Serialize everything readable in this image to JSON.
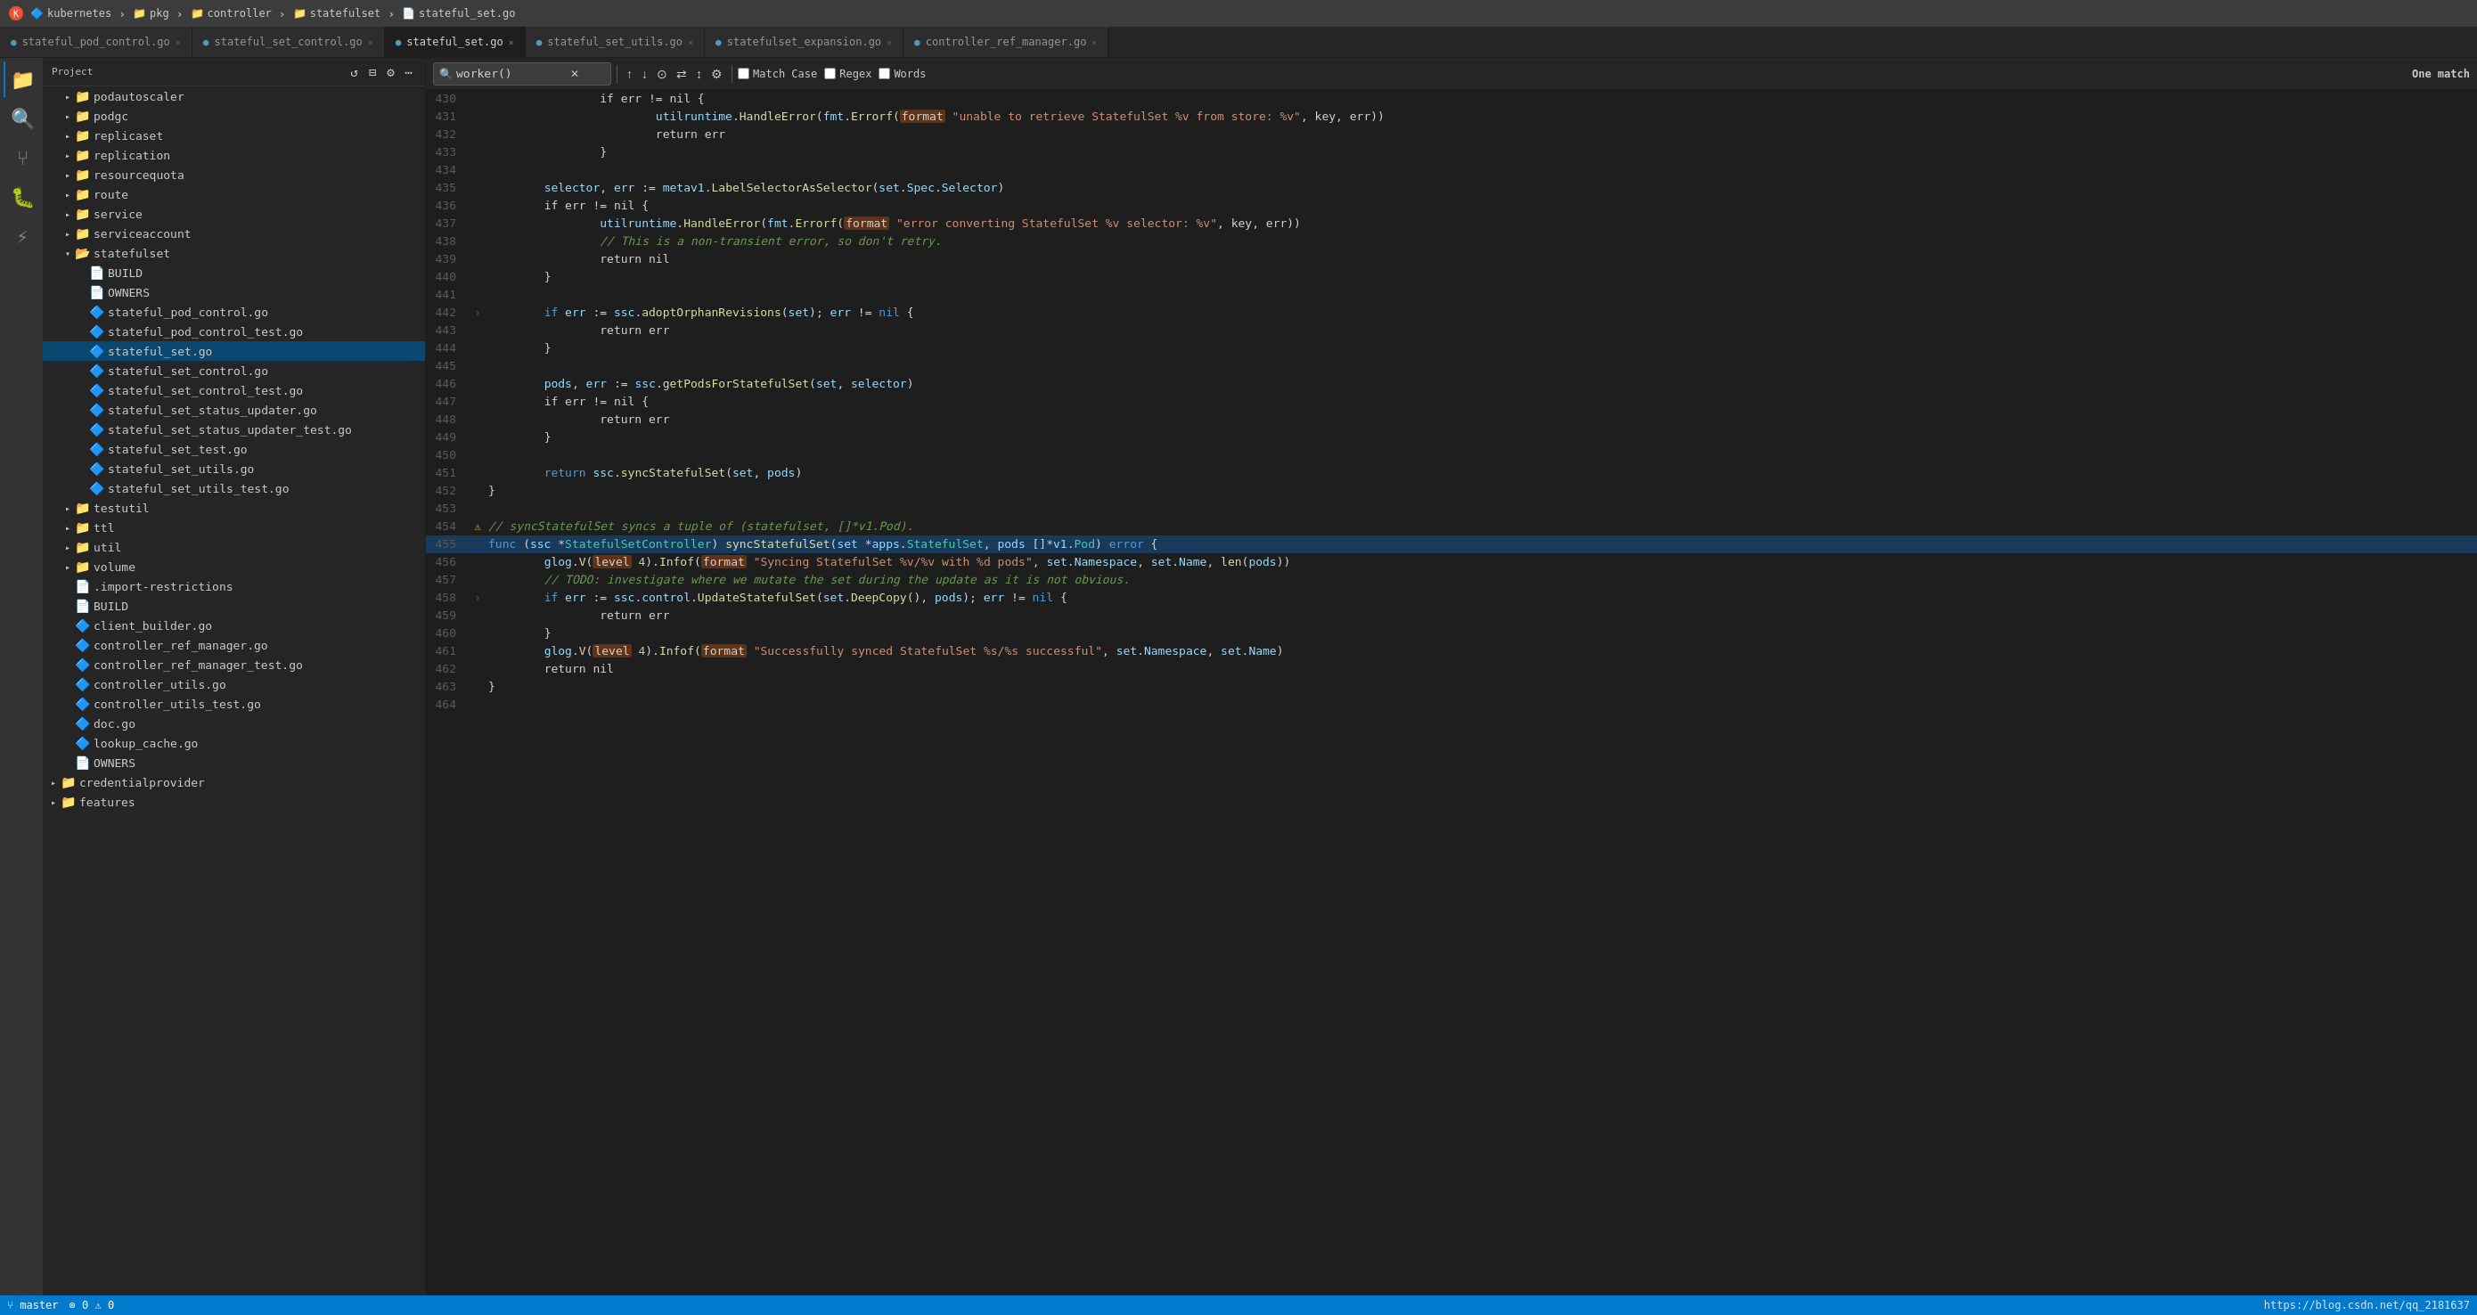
{
  "titlebar": {
    "icon_label": "K",
    "breadcrumb": [
      "kubernetes",
      "pkg",
      "controller",
      "statefulset",
      "stateful_set.go"
    ]
  },
  "tabs": [
    {
      "id": "stateful_pod_control",
      "label": "stateful_pod_control.go",
      "active": false,
      "closable": true
    },
    {
      "id": "stateful_set_control",
      "label": "stateful_set_control.go",
      "active": false,
      "closable": true
    },
    {
      "id": "stateful_set",
      "label": "stateful_set.go",
      "active": true,
      "closable": true
    },
    {
      "id": "stateful_set_utils",
      "label": "stateful_set_utils.go",
      "active": false,
      "closable": true
    },
    {
      "id": "statefulset_expansion",
      "label": "statefulset_expansion.go",
      "active": false,
      "closable": true
    },
    {
      "id": "controller_ref_manager",
      "label": "controller_ref_manager.go",
      "active": false,
      "closable": true
    }
  ],
  "sidebar": {
    "project_label": "Project",
    "tree_items": [
      {
        "id": "podautoscaler",
        "label": "podautoscaler",
        "type": "folder",
        "indent": 1,
        "expanded": false
      },
      {
        "id": "podgc",
        "label": "podgc",
        "type": "folder",
        "indent": 1,
        "expanded": false
      },
      {
        "id": "replicaset",
        "label": "replicaset",
        "type": "folder",
        "indent": 1,
        "expanded": false
      },
      {
        "id": "replication",
        "label": "replication",
        "type": "folder",
        "indent": 1,
        "expanded": false
      },
      {
        "id": "resourcequota",
        "label": "resourcequota",
        "type": "folder",
        "indent": 1,
        "expanded": false
      },
      {
        "id": "route",
        "label": "route",
        "type": "folder",
        "indent": 1,
        "expanded": false
      },
      {
        "id": "service",
        "label": "service",
        "type": "folder",
        "indent": 1,
        "expanded": false
      },
      {
        "id": "serviceaccount",
        "label": "serviceaccount",
        "type": "folder",
        "indent": 1,
        "expanded": false
      },
      {
        "id": "statefulset",
        "label": "statefulset",
        "type": "folder-open",
        "indent": 1,
        "expanded": true
      },
      {
        "id": "BUILD",
        "label": "BUILD",
        "type": "file",
        "indent": 2,
        "expanded": false
      },
      {
        "id": "OWNERS",
        "label": "OWNERS",
        "type": "file",
        "indent": 2,
        "expanded": false
      },
      {
        "id": "stateful_pod_control_go",
        "label": "stateful_pod_control.go",
        "type": "file-go",
        "indent": 2,
        "expanded": false
      },
      {
        "id": "stateful_pod_control_test_go",
        "label": "stateful_pod_control_test.go",
        "type": "file-go",
        "indent": 2,
        "expanded": false
      },
      {
        "id": "stateful_set_go",
        "label": "stateful_set.go",
        "type": "file-go",
        "indent": 2,
        "expanded": false,
        "selected": true
      },
      {
        "id": "stateful_set_control_go",
        "label": "stateful_set_control.go",
        "type": "file-go",
        "indent": 2,
        "expanded": false
      },
      {
        "id": "stateful_set_control_test_go",
        "label": "stateful_set_control_test.go",
        "type": "file-go",
        "indent": 2,
        "expanded": false
      },
      {
        "id": "stateful_set_status_updater_go",
        "label": "stateful_set_status_updater.go",
        "type": "file-go",
        "indent": 2,
        "expanded": false
      },
      {
        "id": "stateful_set_status_updater_test_go",
        "label": "stateful_set_status_updater_test.go",
        "type": "file-go",
        "indent": 2,
        "expanded": false
      },
      {
        "id": "stateful_set_test_go",
        "label": "stateful_set_test.go",
        "type": "file-go",
        "indent": 2,
        "expanded": false
      },
      {
        "id": "stateful_set_utils_go",
        "label": "stateful_set_utils.go",
        "type": "file-go",
        "indent": 2,
        "expanded": false
      },
      {
        "id": "stateful_set_utils_test_go",
        "label": "stateful_set_utils_test.go",
        "type": "file-go",
        "indent": 2,
        "expanded": false
      },
      {
        "id": "testutil",
        "label": "testutil",
        "type": "folder",
        "indent": 1,
        "expanded": false
      },
      {
        "id": "ttl",
        "label": "ttl",
        "type": "folder",
        "indent": 1,
        "expanded": false
      },
      {
        "id": "util",
        "label": "util",
        "type": "folder",
        "indent": 1,
        "expanded": false
      },
      {
        "id": "volume",
        "label": "volume",
        "type": "folder",
        "indent": 1,
        "expanded": false
      },
      {
        "id": "import_restrictions",
        "label": ".import-restrictions",
        "type": "file",
        "indent": 1,
        "expanded": false
      },
      {
        "id": "BUILD2",
        "label": "BUILD",
        "type": "file",
        "indent": 1,
        "expanded": false
      },
      {
        "id": "client_builder_go",
        "label": "client_builder.go",
        "type": "file-go",
        "indent": 1,
        "expanded": false
      },
      {
        "id": "controller_ref_manager_go",
        "label": "controller_ref_manager.go",
        "type": "file-go",
        "indent": 1,
        "expanded": false
      },
      {
        "id": "controller_ref_manager_test_go",
        "label": "controller_ref_manager_test.go",
        "type": "file-go",
        "indent": 1,
        "expanded": false
      },
      {
        "id": "controller_utils_go",
        "label": "controller_utils.go",
        "type": "file-go",
        "indent": 1,
        "expanded": false
      },
      {
        "id": "controller_utils_test_go",
        "label": "controller_utils_test.go",
        "type": "file-go",
        "indent": 1,
        "expanded": false
      },
      {
        "id": "doc_go",
        "label": "doc.go",
        "type": "file-go",
        "indent": 1,
        "expanded": false
      },
      {
        "id": "lookup_cache_go",
        "label": "lookup_cache.go",
        "type": "file-go",
        "indent": 1,
        "expanded": false
      },
      {
        "id": "OWNERS2",
        "label": "OWNERS",
        "type": "file",
        "indent": 1,
        "expanded": false
      },
      {
        "id": "credentialprovider",
        "label": "credentialprovider",
        "type": "folder",
        "indent": 0,
        "expanded": false
      },
      {
        "id": "features",
        "label": "features",
        "type": "folder",
        "indent": 0,
        "expanded": false
      }
    ]
  },
  "search": {
    "query": "worker()",
    "match_case": false,
    "regex": false,
    "words": false,
    "result": "One match"
  },
  "code": {
    "lines": [
      {
        "num": 430,
        "content": "\t\tif err != nil {",
        "fold": false
      },
      {
        "num": 431,
        "content": "\t\t\tutilruntime.HandleError(fmt.Errorf([format] \"unable to retrieve StatefulSet %v from store: %v\", key, err))",
        "fold": false,
        "has_highlight": true,
        "highlight_word": "format"
      },
      {
        "num": 432,
        "content": "\t\t\treturn err",
        "fold": false
      },
      {
        "num": 433,
        "content": "\t\t}",
        "fold": false
      },
      {
        "num": 434,
        "content": "",
        "fold": false
      },
      {
        "num": 435,
        "content": "\tselector, err := metav1.LabelSelectorAsSelector(set.Spec.Selector)",
        "fold": false
      },
      {
        "num": 436,
        "content": "\tif err != nil {",
        "fold": false
      },
      {
        "num": 437,
        "content": "\t\tutilruntime.HandleError(fmt.Errorf([format] \"error converting StatefulSet %v selector: %v\", key, err))",
        "fold": false,
        "has_highlight": true,
        "highlight_word": "format"
      },
      {
        "num": 438,
        "content": "\t\t// This is a non-transient error, so don't retry.",
        "fold": false,
        "is_comment": true
      },
      {
        "num": 439,
        "content": "\t\treturn nil",
        "fold": false
      },
      {
        "num": 440,
        "content": "\t}",
        "fold": false
      },
      {
        "num": 441,
        "content": "",
        "fold": false
      },
      {
        "num": 442,
        "content": "\tif err := ssc.adoptOrphanRevisions(set); err != nil {",
        "fold": true
      },
      {
        "num": 443,
        "content": "\t\treturn err",
        "fold": false
      },
      {
        "num": 444,
        "content": "\t}",
        "fold": false
      },
      {
        "num": 445,
        "content": "",
        "fold": false
      },
      {
        "num": 446,
        "content": "\tpods, err := ssc.getPodsForStatefulSet(set, selector)",
        "fold": false
      },
      {
        "num": 447,
        "content": "\tif err != nil {",
        "fold": false
      },
      {
        "num": 448,
        "content": "\t\treturn err",
        "fold": false
      },
      {
        "num": 449,
        "content": "\t}",
        "fold": false
      },
      {
        "num": 450,
        "content": "",
        "fold": false
      },
      {
        "num": 451,
        "content": "\treturn ssc.syncStatefulSet(set, pods)",
        "fold": false
      },
      {
        "num": 452,
        "content": "}",
        "fold": false
      },
      {
        "num": 453,
        "content": "",
        "fold": false
      },
      {
        "num": 454,
        "content": "// syncStatefulSet syncs a tuple of (statefulset, []*v1.Pod).",
        "fold": false,
        "is_comment": true,
        "has_warning": true
      },
      {
        "num": 455,
        "content": "func (ssc *StatefulSetController) syncStatefulSet(set *apps.StatefulSet, pods []*v1.Pod) error {",
        "fold": false,
        "is_active": true
      },
      {
        "num": 456,
        "content": "\tglog.V([level] 4).Infof([format] \"Syncing StatefulSet %v/%v with %d pods\", set.Namespace, set.Name, len(pods))",
        "fold": false,
        "has_highlight": true
      },
      {
        "num": 457,
        "content": "\t// TODO: investigate where we mutate the set during the update as it is not obvious.",
        "fold": false,
        "is_comment": true
      },
      {
        "num": 458,
        "content": "\tif err := ssc.control.UpdateStatefulSet(set.DeepCopy(), pods); err != nil {",
        "fold": true
      },
      {
        "num": 459,
        "content": "\t\treturn err",
        "fold": false
      },
      {
        "num": 460,
        "content": "\t}",
        "fold": false
      },
      {
        "num": 461,
        "content": "\tglog.V([level] 4).Infof([format] \"Successfully synced StatefulSet %s/%s successful\", set.Namespace, set.Name)",
        "fold": false,
        "has_highlight": true
      },
      {
        "num": 462,
        "content": "\treturn nil",
        "fold": false
      },
      {
        "num": 463,
        "content": "}",
        "fold": false
      },
      {
        "num": 464,
        "content": "",
        "fold": false
      }
    ]
  },
  "statusbar": {
    "url": "https://blog.csdn.net/qq_2181637"
  }
}
